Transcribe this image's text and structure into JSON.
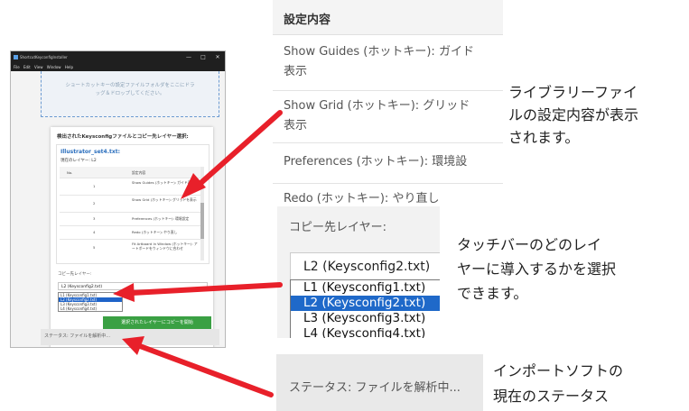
{
  "app": {
    "title": "ShortcutKeyconfigInstaller",
    "window_controls": [
      "—",
      "□",
      "✕"
    ],
    "menu": [
      "File",
      "Edit",
      "View",
      "Window",
      "Help"
    ],
    "dropzone_text_1": "ショートカットキーの設定ファイルフォルダをここにドラ",
    "dropzone_text_2": "ッグ＆ドロップしてください。",
    "card_title": "検出されたKeysconfigファイルとコピー先レイヤー選択:",
    "file_name": "Illustrator_set4.txt:",
    "current_layer": "現在のレイヤー: L2",
    "table_headers": [
      "No.",
      "設定内容"
    ],
    "table_rows": [
      {
        "no": "1",
        "desc": "Show Guides (ホットキー): ガイド表示"
      },
      {
        "no": "2",
        "desc": "Show Grid (ホットキー): グリッドを表示"
      },
      {
        "no": "3",
        "desc": "Preferences (ホットキー): 環境設定"
      },
      {
        "no": "4",
        "desc": "Redo (ホットキー): やり直し"
      },
      {
        "no": "5",
        "desc": "Fit Artboard In Window (ホットキー): アートボードをウィンドウに合わせ"
      }
    ],
    "copy_label": "コピー先レイヤー:",
    "selected_layer": "L2 (Keysconfig2.txt)",
    "layer_options": [
      "L1 (Keysconfig1.txt)",
      "L2 (Keysconfig2.txt)",
      "L3 (Keysconfig3.txt)",
      "L4 (Keysconfig4.txt)"
    ],
    "copy_button": "選択されたレイヤーにコピーを開始",
    "status": "ステータス: ファイルを解析中..."
  },
  "zoom_settings": {
    "header": "設定内容",
    "rows": [
      "Show Guides (ホットキー): ガイド\n表示",
      "Show Grid (ホットキー): グリッド\n表示",
      "Preferences (ホットキー): 環境設",
      "Redo (ホットキー): やり直し"
    ]
  },
  "zoom_layer": {
    "label": "コピー先レイヤー:",
    "selected": "L2 (Keysconfig2.txt)",
    "options": [
      "L1 (Keysconfig1.txt)",
      "L2 (Keysconfig2.txt)",
      "L3 (Keysconfig3.txt)",
      "L4 (Keysconfig4.txt)"
    ]
  },
  "zoom_status": {
    "text": "ステータス: ファイルを解析中..."
  },
  "captions": {
    "c1": [
      "ライブラリーファイ",
      "ルの設定内容が表示",
      "されます。"
    ],
    "c2": [
      "タッチバーのどのレイ",
      "ヤーに導入するかを選択",
      "できます。"
    ],
    "c3": [
      "インポートソフトの",
      "現在のステータス"
    ]
  },
  "colors": {
    "arrow": "#e8202a",
    "accent": "#2a6ebd",
    "button": "#3aa043",
    "selection": "#1f69c9"
  }
}
